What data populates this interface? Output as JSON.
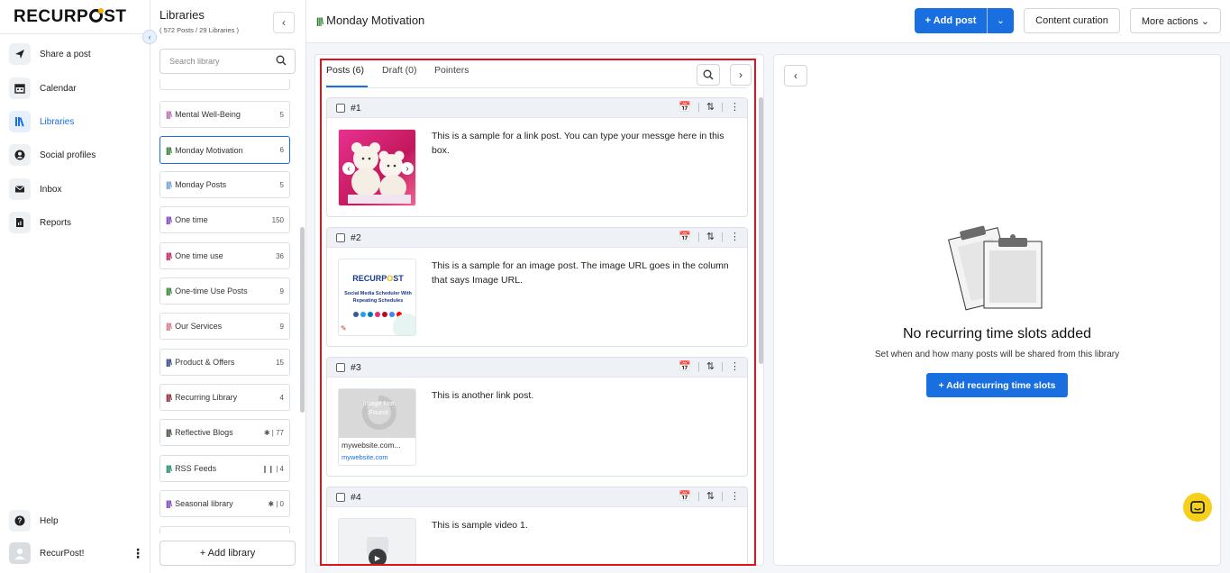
{
  "brand": {
    "logo_text_left": "RECURP",
    "logo_text_right": "ST"
  },
  "nav": {
    "items": [
      {
        "label": "Share a post",
        "icon": "send-icon"
      },
      {
        "label": "Calendar",
        "icon": "calendar-icon"
      },
      {
        "label": "Libraries",
        "icon": "libraries-icon",
        "active": true
      },
      {
        "label": "Social profiles",
        "icon": "user-circle-icon"
      },
      {
        "label": "Inbox",
        "icon": "inbox-icon"
      },
      {
        "label": "Reports",
        "icon": "reports-icon"
      }
    ],
    "help_label": "Help",
    "account_label": "RecurPost!"
  },
  "libraries": {
    "title": "Libraries",
    "subtitle": "( 572 Posts / 29 Libraries )",
    "search_placeholder": "Search library",
    "add_label": "+ Add library",
    "items": [
      {
        "label": "Mental Well-Being",
        "count": "5",
        "color": "#b56bb3"
      },
      {
        "label": "Monday Motivation",
        "count": "6",
        "color": "#2e7d32",
        "active": true
      },
      {
        "label": "Monday Posts",
        "count": "5",
        "color": "#6f9fd8"
      },
      {
        "label": "One time",
        "count": "150",
        "color": "#7b3fb5"
      },
      {
        "label": "One time use",
        "count": "36",
        "color": "#c2185b"
      },
      {
        "label": "One-time Use Posts",
        "count": "9",
        "color": "#2e7d32"
      },
      {
        "label": "Our Services",
        "count": "9",
        "color": "#d47a8a"
      },
      {
        "label": "Product & Offers",
        "count": "15",
        "color": "#2c3e7a"
      },
      {
        "label": "Recurring Library",
        "count": "4",
        "color": "#8b2232"
      },
      {
        "label": "Reflective Blogs",
        "count": "✱ | 77",
        "color": "#3e4a3c"
      },
      {
        "label": "RSS Feeds",
        "count": "❙❙ | 4",
        "color": "#1b8a6b"
      },
      {
        "label": "Seasonal library",
        "count": "✱ | 0",
        "color": "#7b3fb5"
      }
    ]
  },
  "header": {
    "title": "Monday Motivation",
    "add_post": "+ Add post",
    "content_curation": "Content curation",
    "more_actions": "More actions ⌄"
  },
  "posts": {
    "tabs": [
      "Posts (6)",
      "Draft (0)",
      "Pointers"
    ],
    "items": [
      {
        "num": "#1",
        "text": "This is a sample for a link post. You can type your messge here in this box."
      },
      {
        "num": "#2",
        "text": "This is a sample for an image post. The image URL goes in the column that says Image URL."
      },
      {
        "num": "#3",
        "text": "This is another link post.",
        "link_title": "mywebsite.com...",
        "link_domain": "mywebsite.com",
        "placeholder_text": "Image Not Found"
      },
      {
        "num": "#4",
        "text": "This is sample video 1."
      }
    ],
    "thumb2": {
      "brand_left": "RECURP",
      "brand_right": "ST",
      "caption": "Social Media Scheduler With Repeating Schedules"
    }
  },
  "slots": {
    "title": "No recurring time slots added",
    "subtitle": "Set when and how many posts will be shared from this library",
    "button": "+ Add recurring time slots"
  }
}
